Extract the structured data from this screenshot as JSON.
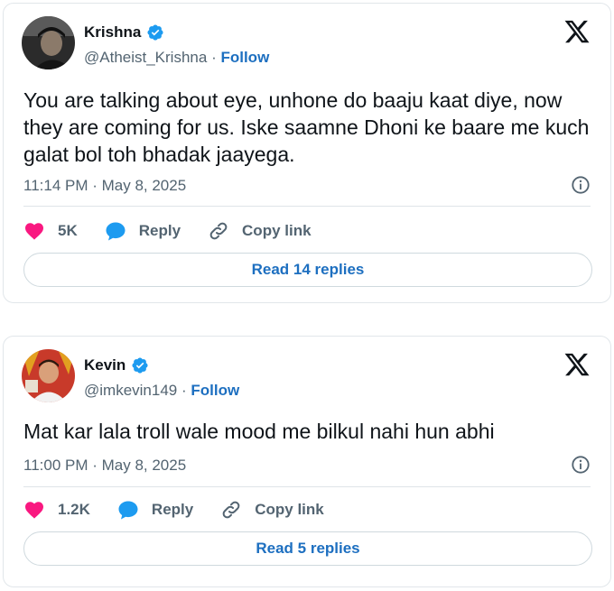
{
  "tweets": [
    {
      "name": "Krishna",
      "handle": "@Atheist_Krishna",
      "separator": "·",
      "follow_label": "Follow",
      "text": "You are talking about eye, unhone do baaju kaat diye, now they are coming  for us.  Iske saamne Dhoni ke baare me kuch galat bol toh bhadak jaayega.",
      "timestamp": "11:14 PM · May 8, 2025",
      "likes": "5K",
      "reply_label": "Reply",
      "copy_label": "Copy link",
      "read_replies_label": "Read 14 replies"
    },
    {
      "name": "Kevin",
      "handle": "@imkevin149",
      "separator": "·",
      "follow_label": "Follow",
      "text": "Mat kar lala troll wale mood me bilkul nahi hun abhi",
      "timestamp": "11:00 PM · May 8, 2025",
      "likes": "1.2K",
      "reply_label": "Reply",
      "copy_label": "Copy link",
      "read_replies_label": "Read 5 replies"
    }
  ],
  "colors": {
    "accent": "#1d6fc0",
    "verified": "#1d9bf0",
    "like": "#f91880",
    "muted": "#536471"
  },
  "icons": [
    "verified-badge-icon",
    "x-logo-icon",
    "info-icon",
    "heart-icon",
    "reply-bubble-icon",
    "link-icon"
  ]
}
